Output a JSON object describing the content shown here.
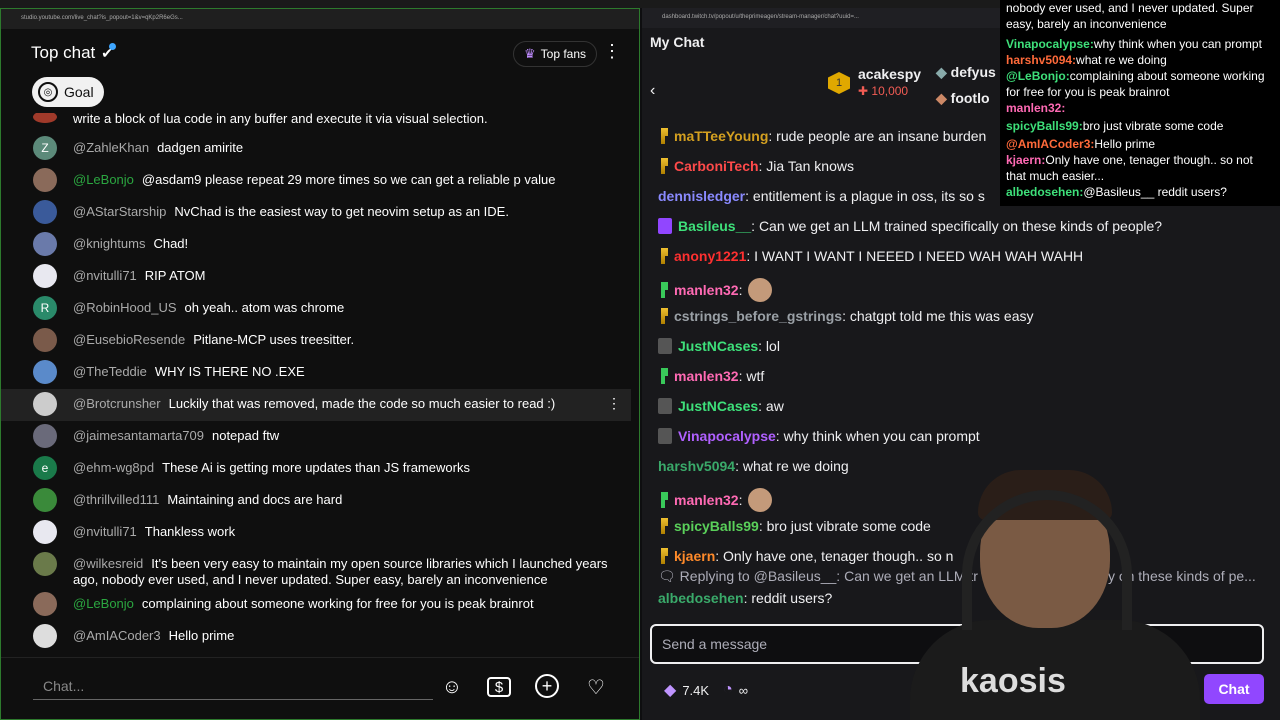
{
  "yt": {
    "url": "studio.youtube.com/live_chat?is_popout=1&v=qKp2R6eGs...",
    "title": "Top chat",
    "top_fans": "Top fans",
    "goal": "Goal",
    "prev_text": "write a block of lua code in any buffer and execute it via visual selection.",
    "messages": [
      {
        "user": "@ZahleKhan",
        "text": "dadgen amirite",
        "color": "#5c8a7a",
        "initial": "Z"
      },
      {
        "user": "@LeBonjo",
        "text": "@asdam9 please repeat 29 more times so we can get a reliable p value",
        "color": "#8a6a5a",
        "initial": ""
      },
      {
        "user": "@AStarStarship",
        "text": "NvChad is the easiest way to get neovim setup as an IDE.",
        "color": "#3a5a9a",
        "initial": ""
      },
      {
        "user": "@knightums",
        "text": "Chad!",
        "color": "#6a7aaa",
        "initial": ""
      },
      {
        "user": "@nvitulli71",
        "text": "RIP ATOM",
        "color": "#e8e8f0",
        "initial": ""
      },
      {
        "user": "@RobinHood_US",
        "text": "oh yeah.. atom was chrome",
        "color": "#2a8a6a",
        "initial": "R"
      },
      {
        "user": "@EusebioResende",
        "text": "Pitlane-MCP uses treesitter.",
        "color": "#7a5a4a",
        "initial": ""
      },
      {
        "user": "@TheTeddie",
        "text": "WHY IS THERE NO .EXE",
        "color": "#5a8aca",
        "initial": ""
      },
      {
        "user": "@Brotcrunsher",
        "text": "Luckily that was removed, made the code so much easier to read :)",
        "color": "#cccccc",
        "initial": ""
      },
      {
        "user": "@jaimesantamarta709",
        "text": "notepad ftw",
        "color": "#6a6a7a",
        "initial": ""
      },
      {
        "user": "@ehm-wg8pd",
        "text": "These Ai is getting more updates than JS frameworks",
        "color": "#1a7a4a",
        "initial": "e"
      },
      {
        "user": "@thrillvilled111",
        "text": "Maintaining and docs are hard",
        "color": "#3a8a3a",
        "initial": ""
      },
      {
        "user": "@nvitulli71",
        "text": "Thankless work",
        "color": "#e8e8f0",
        "initial": ""
      },
      {
        "user": "@wilkesreid",
        "text": "It's been very easy to maintain my open source libraries which I launched years ago, nobody ever used, and I never updated. Super easy, barely an inconvenience",
        "color": "#6a7a4a",
        "initial": ""
      },
      {
        "user": "@LeBonjo",
        "text": "complaining about someone working for free for you is peak brainrot",
        "color": "#8a6a5a",
        "initial": ""
      },
      {
        "user": "@AmIACoder3",
        "text": "Hello prime",
        "color": "#dddddd",
        "initial": ""
      }
    ],
    "placeholder": "Chat..."
  },
  "tw": {
    "url": "dashboard.twitch.tv/popout/u/theprimeagen/stream-manager/chat?uuid=...",
    "title": "My Chat",
    "leader1_name": "acakespy",
    "leader1_pts": "10,000",
    "leader2_name": "defyus",
    "leader3_name": "footlo",
    "messages": [
      {
        "user": "maTTeeYoung",
        "text": ": rude people are an insane burden",
        "color": "#d4a020",
        "badge": "b-bits"
      },
      {
        "user": "CarboniTech",
        "text": ": Jia Tan knows",
        "color": "#ff4a4a",
        "badge": "b-bits"
      },
      {
        "user": "dennisledger",
        "text": ": entitlement is a plague in oss, its so s",
        "color": "#8a8aff",
        "badge": ""
      },
      {
        "user": "Basileus__",
        "text": ": Can we get an LLM trained specifically on these kinds of people?",
        "color": "#3ee07a",
        "badge": "b-purple"
      },
      {
        "user": "anony1221",
        "text": ": I WANT I WANT I NEEED I NEED WAH WAH WAHH",
        "color": "#ff3030",
        "badge": "b-bits"
      },
      {
        "user": "manlen32",
        "text": ":",
        "color": "#ff6ab4",
        "badge": "b-green"
      },
      {
        "user": "cstrings_before_gstrings",
        "text": ": chatgpt told me this was easy",
        "color": "#9aa0a6",
        "badge": "b-bits"
      },
      {
        "user": "JustNCases",
        "text": ": lol",
        "color": "#3ee07a",
        "badge": "b-dice"
      },
      {
        "user": "manlen32",
        "text": ": wtf",
        "color": "#ff6ab4",
        "badge": "b-green"
      },
      {
        "user": "JustNCases",
        "text": ": aw",
        "color": "#3ee07a",
        "badge": "b-dice"
      },
      {
        "user": "Vinapocalypse",
        "text": ": why think when you can prompt",
        "color": "#b060ff",
        "badge": "b-dice"
      },
      {
        "user": "harshv5094",
        "text": ": what re we doing",
        "color": "#3aaa6a",
        "badge": ""
      },
      {
        "user": "manlen32",
        "text": ":",
        "color": "#ff6ab4",
        "badge": "b-green"
      },
      {
        "user": "spicyBalls99",
        "text": ": bro just vibrate some code",
        "color": "#5ad05a",
        "badge": "b-bits"
      },
      {
        "user": "kjaern",
        "text": ": Only have one, tenager though.. so n",
        "color": "#ff8a2a",
        "badge": "b-bits"
      }
    ],
    "reply_text": "Replying to @Basileus__: Can we get an LLM tr",
    "reply_tail": "y on these kinds of pe...",
    "last_user": "albedosehen",
    "last_text": ": reddit users?",
    "placeholder": "Send a message",
    "points": "7.4K",
    "infinity": "∞",
    "chat_button": "Chat"
  },
  "overlay": [
    {
      "user": "",
      "text": "nobody ever used, and I never updated. Super easy, barely an inconvenience",
      "color": "#ffffff"
    },
    {
      "user": "Vinapocalypse:",
      "text": "why think when you can prompt",
      "color": "#3ee07a"
    },
    {
      "user": "harshv5094:",
      "text": "what re we doing",
      "color": "#ff6a3a"
    },
    {
      "user": "@LeBonjo:",
      "text": "complaining about someone working for free for you is peak brainrot",
      "color": "#3ee07a"
    },
    {
      "user": "manlen32:",
      "text": "",
      "color": "#ff6ab4"
    },
    {
      "user": "spicyBalls99:",
      "text": "bro just vibrate some code",
      "color": "#3ee07a"
    },
    {
      "user": "@AmIACoder3:",
      "text": "Hello prime",
      "color": "#ff6a3a"
    },
    {
      "user": "kjaern:",
      "text": "Only have one, tenager though.. so not that much easier...",
      "color": "#ff6ab4"
    },
    {
      "user": "albedosehen:",
      "text": "@Basileus__ reddit users?",
      "color": "#3ee07a"
    }
  ],
  "cam_logo": "kaosis"
}
